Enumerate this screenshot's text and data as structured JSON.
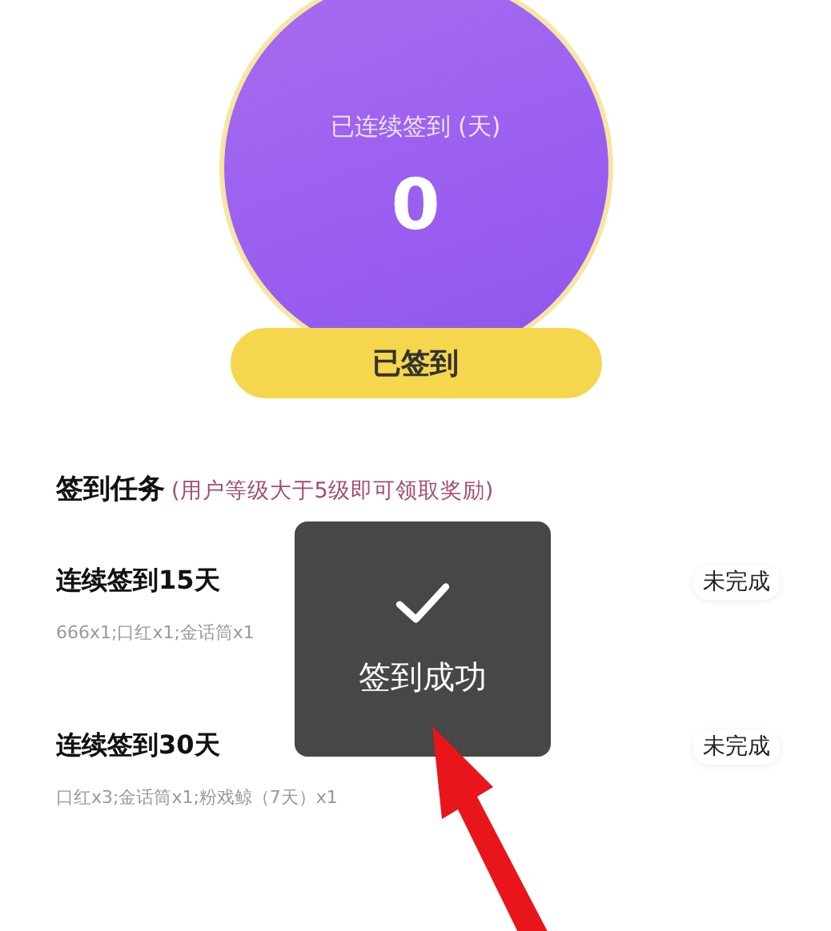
{
  "checkin": {
    "label": "已连续签到 (天)",
    "days": "0",
    "button": "已签到",
    "checked_in": true
  },
  "tasks_header": {
    "title": "签到任务",
    "note": "(用户等级大于5级即可领取奖励)"
  },
  "tasks": [
    {
      "title": "连续签到15天",
      "rewards": "666x1;口红x1;金话筒x1",
      "status": "未完成"
    },
    {
      "title": "连续签到30天",
      "rewards": "口红x3;金话筒x1;粉戏鲸（7天）x1",
      "status": "未完成"
    }
  ],
  "toast": {
    "message": "签到成功"
  }
}
